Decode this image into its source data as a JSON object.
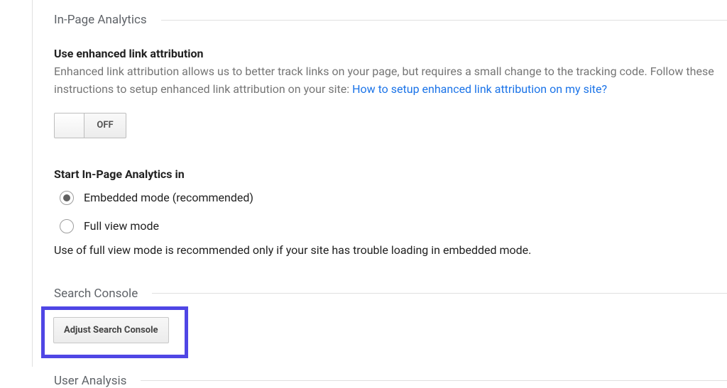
{
  "inpage": {
    "title": "In-Page Analytics",
    "enhanced": {
      "heading": "Use enhanced link attribution",
      "desc_before_link": "Enhanced link attribution allows us to better track links on your page, but requires a small change to the tracking code. Follow these instructions to setup enhanced link attribution on your site: ",
      "link_text": "How to setup enhanced link attribution on my site?",
      "toggle_state": "OFF"
    },
    "start_in": {
      "heading": "Start In-Page Analytics in",
      "options": [
        {
          "label": "Embedded mode (recommended)",
          "selected": true
        },
        {
          "label": "Full view mode",
          "selected": false
        }
      ],
      "note": "Use of full view mode is recommended only if your site has trouble loading in embedded mode."
    }
  },
  "search_console": {
    "title": "Search Console",
    "button": "Adjust Search Console"
  },
  "user_analysis": {
    "title": "User Analysis"
  }
}
